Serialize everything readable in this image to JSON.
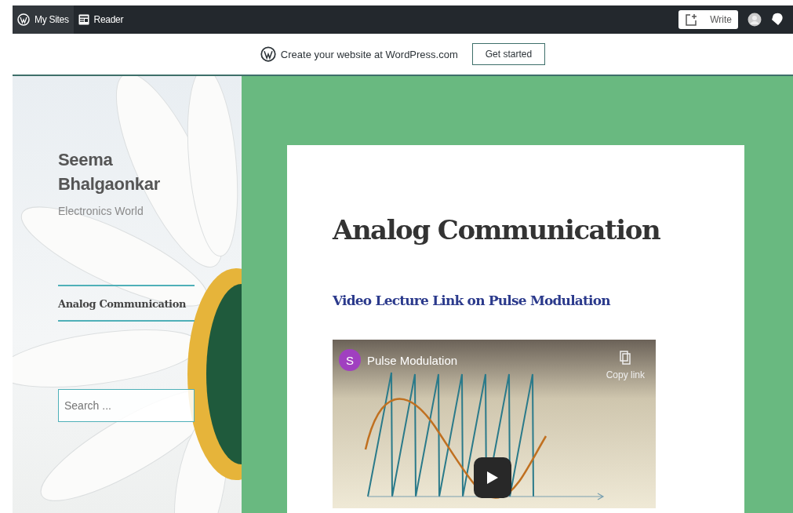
{
  "top_bar": {
    "items": [
      {
        "label": "My Sites",
        "kind": "sites",
        "selected": true
      },
      {
        "label": "Reader",
        "kind": "reader",
        "selected": false
      }
    ],
    "write_button": "Write"
  },
  "banner": {
    "text": "Create your website at WordPress.com",
    "button": "Get started"
  },
  "sidebar": {
    "site_title": "Seema Bhalgaonkar",
    "tagline": "Electronics World",
    "menu": [
      {
        "label": "Analog Communication"
      }
    ],
    "search": {
      "placeholder": "Search ..."
    }
  },
  "post": {
    "title": "Analog Communication",
    "link": "Video Lecture Link on Pulse Modulation",
    "video": {
      "channel_initial": "S",
      "title": "Pulse Modulation",
      "copy_link": "Copy link"
    }
  }
}
